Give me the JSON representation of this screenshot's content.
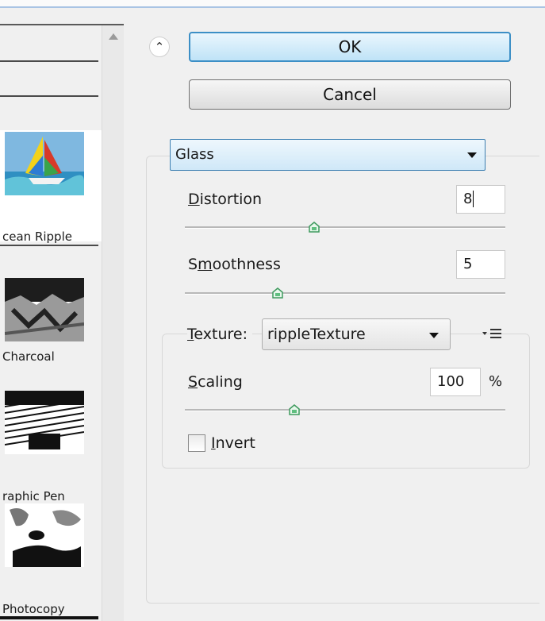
{
  "gallery": {
    "items": [
      {
        "label": "cean Ripple",
        "selected": true
      },
      {
        "label": "Charcoal",
        "selected": false
      },
      {
        "label": "raphic Pen",
        "selected": false
      },
      {
        "label": "Photocopy",
        "selected": false
      }
    ]
  },
  "buttons": {
    "collapse_icon": "⌃",
    "ok_label": "OK",
    "cancel_label": "Cancel"
  },
  "filter": {
    "selected": "Glass"
  },
  "params": {
    "distortion": {
      "label_key": "D",
      "label_rest": "istortion",
      "value": "8",
      "slider_level": 0.4
    },
    "smoothness": {
      "label_pre": "S",
      "label_key": "m",
      "label_rest": "oothness",
      "value": "5",
      "slider_level": 0.3
    }
  },
  "texture": {
    "label_key": "T",
    "label_rest": "exture:",
    "selected": "rippleTexture",
    "scaling": {
      "label_key": "S",
      "label_rest": "caling",
      "value": "100",
      "unit": "%",
      "slider_level": 0.34
    },
    "invert": {
      "label_key": "I",
      "label_rest": "nvert",
      "checked": false
    }
  },
  "colors": {
    "accent_border": "#3c8fc6",
    "slider_thumb": "#5fbf7f"
  }
}
